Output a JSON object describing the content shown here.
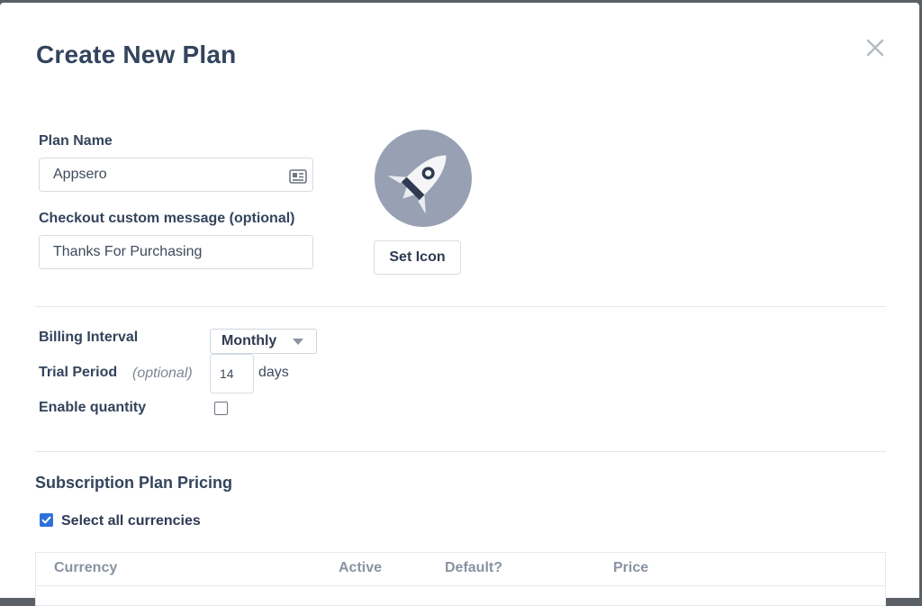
{
  "modal": {
    "title": "Create New Plan",
    "close_icon": "close-icon"
  },
  "plan_name": {
    "label": "Plan Name",
    "value": "Appsero",
    "field_icon": "contact-card-icon"
  },
  "checkout_message": {
    "label": "Checkout custom message (optional)",
    "value": "Thanks For Purchasing"
  },
  "icon_picker": {
    "icon": "rocket-icon",
    "button_label": "Set Icon",
    "background_color": "#97a1b3"
  },
  "billing": {
    "interval_label": "Billing Interval",
    "interval_value": "Monthly",
    "trial_label": "Trial Period",
    "trial_optional": "(optional)",
    "trial_value": "14",
    "trial_unit": "days",
    "quantity_label": "Enable quantity",
    "quantity_enabled": false
  },
  "pricing": {
    "section_title": "Subscription Plan Pricing",
    "select_all_label": "Select all currencies",
    "select_all_checked": true,
    "columns": [
      "Currency",
      "Active",
      "Default?",
      "Price"
    ]
  },
  "colors": {
    "heading": "#33445c",
    "accent": "#2d72d9",
    "border": "#d7dce3"
  }
}
